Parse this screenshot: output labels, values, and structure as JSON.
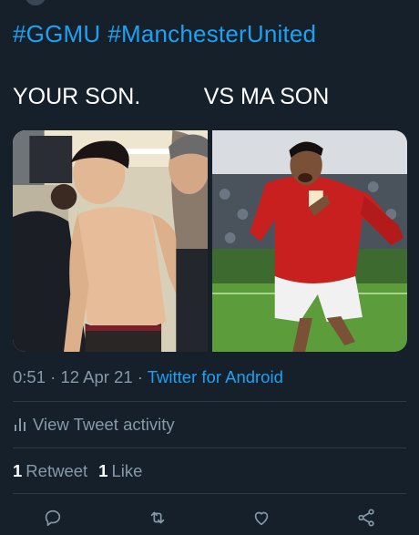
{
  "tweet": {
    "hashtags": [
      "#GGMU",
      "#ManchesterUnited"
    ],
    "caption": "YOUR SON.          VS MA SON",
    "time": "0:51",
    "date": "12 Apr 21",
    "separator": " · ",
    "source": "Twitter for Android"
  },
  "media": {
    "left_photo": "photo-crying-player",
    "right_photo": "photo-celebrating-player"
  },
  "activity": {
    "label": "View Tweet activity",
    "icon": "bar-chart-icon"
  },
  "stats": {
    "retweets_count": "1",
    "retweets_label": "Retweet",
    "likes_count": "1",
    "likes_label": "Like"
  },
  "actions": {
    "reply_icon": "reply-icon",
    "retweet_icon": "retweet-icon",
    "like_icon": "heart-icon",
    "share_icon": "share-icon"
  },
  "colors": {
    "background": "#15202b",
    "link": "#1da1f2",
    "muted": "#8899a6",
    "divider": "#2c3a48"
  }
}
